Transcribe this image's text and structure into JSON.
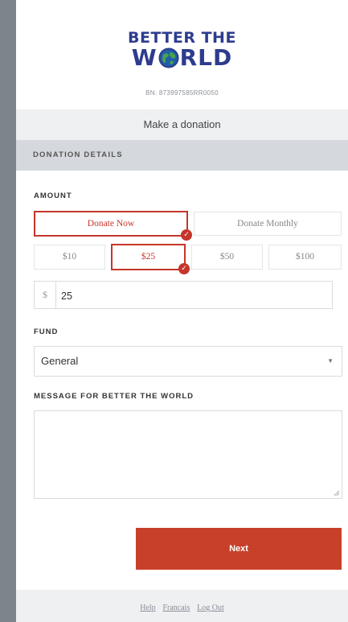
{
  "brand": {
    "line1": "BETTER THE",
    "line2_left": "W",
    "line2_right": "RLD",
    "bn": "BN: 873997585RR0050",
    "color": "#2d3c8e"
  },
  "header": {
    "title": "Make a donation"
  },
  "section": {
    "title": "DONATION DETAILS"
  },
  "amount": {
    "label": "AMOUNT",
    "frequency": [
      {
        "label": "Donate Now",
        "selected": true
      },
      {
        "label": "Donate Monthly",
        "selected": false
      }
    ],
    "presets": [
      {
        "label": "$10",
        "selected": false
      },
      {
        "label": "$25",
        "selected": true
      },
      {
        "label": "$50",
        "selected": false
      },
      {
        "label": "$100",
        "selected": false
      }
    ],
    "currency_symbol": "$",
    "value": "25"
  },
  "fund": {
    "label": "FUND",
    "selected": "General"
  },
  "message": {
    "label": "MESSAGE FOR BETTER THE WORLD",
    "value": ""
  },
  "actions": {
    "next_label": "Next"
  },
  "footer": {
    "links": [
      "Help",
      "Francais",
      "Log Out"
    ]
  },
  "colors": {
    "accent": "#c5362a",
    "button": "#c8402a",
    "background": "#7d848c"
  }
}
